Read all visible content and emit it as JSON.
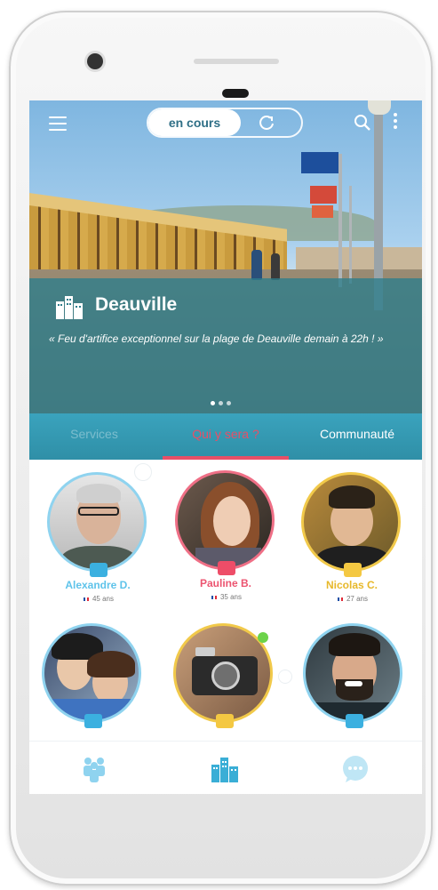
{
  "top_bar": {
    "toggle_active_label": "en cours",
    "menu_icon": "hamburger-icon",
    "refresh_icon": "refresh-icon",
    "search_icon": "search-icon",
    "more_icon": "more-vertical-icon"
  },
  "hero": {
    "city_icon": "city-buildings-icon",
    "city_name": "Deauville",
    "quote": "« Feu d'artifice exceptionnel sur la plage de Deauville demain à 22h ! »",
    "carousel_dots": 3,
    "carousel_active_index": 0
  },
  "tabs": {
    "items": [
      {
        "label": "Services"
      },
      {
        "label": "Qui y sera ?"
      },
      {
        "label": "Communauté"
      }
    ],
    "active_index": 1
  },
  "people": [
    {
      "name": "Alexandre D.",
      "age": "45 ans",
      "color": "#5ec3ea"
    },
    {
      "name": "Pauline B.",
      "age": "35 ans",
      "color": "#ec5470"
    },
    {
      "name": "Nicolas C.",
      "age": "27 ans",
      "color": "#e7b82a"
    },
    {
      "name": "",
      "age": "",
      "color": "#5ec3ea"
    },
    {
      "name": "",
      "age": "",
      "color": "#f1c94a"
    },
    {
      "name": "",
      "age": "",
      "color": "#5ec3ea"
    }
  ],
  "bottom_nav": [
    {
      "icon": "community-people-icon"
    },
    {
      "icon": "city-buildings-icon"
    },
    {
      "icon": "chat-bubble-icon"
    }
  ],
  "colors": {
    "teal": "#2f8fa7",
    "accent_red": "#e84f67",
    "accent_blue": "#5ec3ea",
    "accent_yellow": "#f1c94a"
  }
}
